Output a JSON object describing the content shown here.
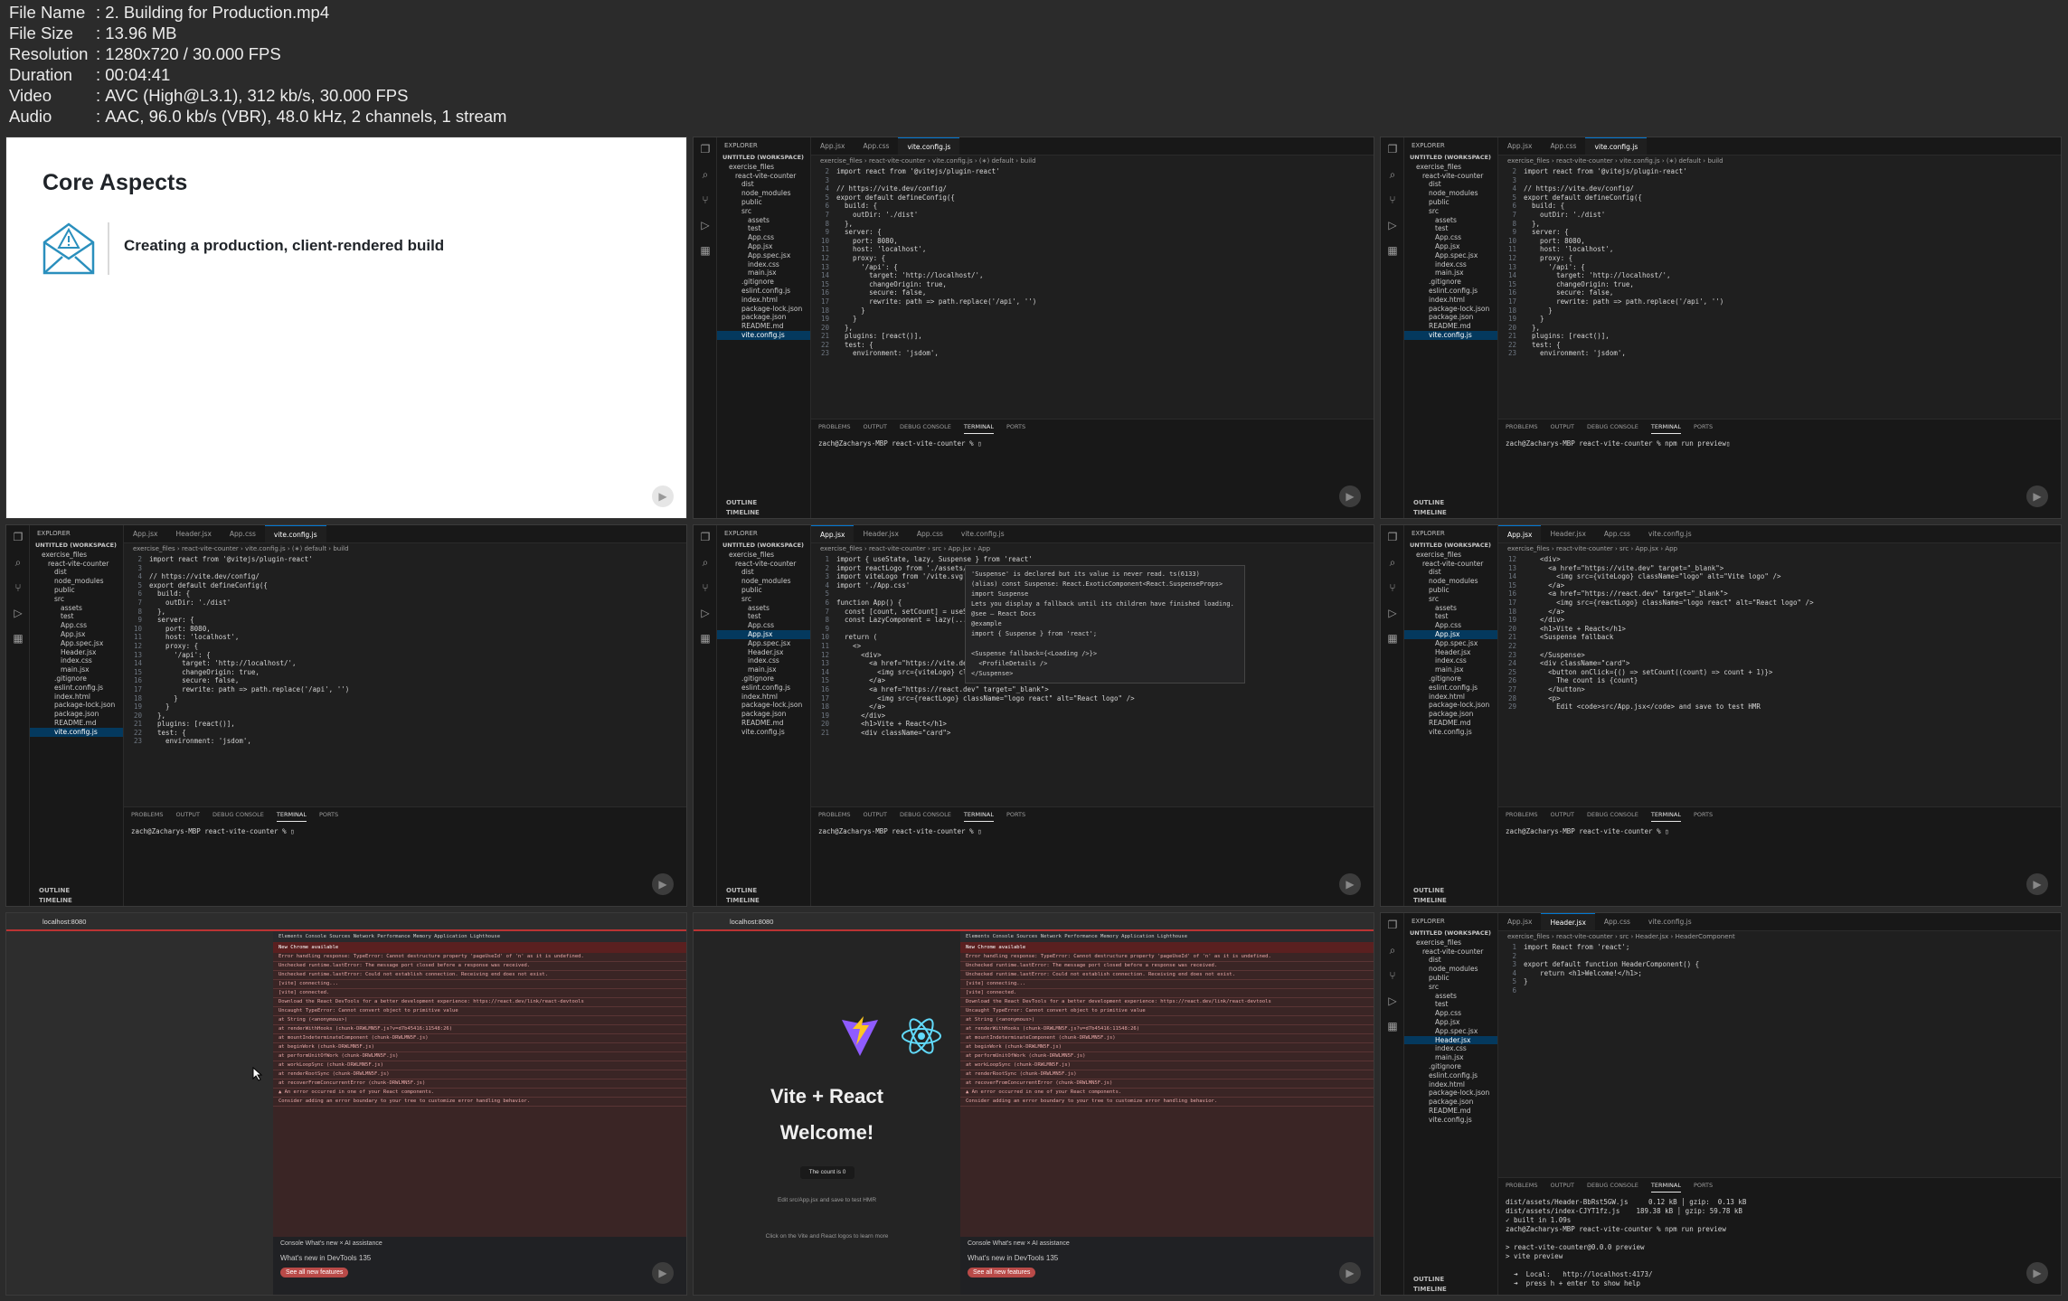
{
  "meta": [
    {
      "key": "File Name",
      "value": "2. Building for Production.mp4"
    },
    {
      "key": "File Size",
      "value": "13.96 MB"
    },
    {
      "key": "Resolution",
      "value": "1280x720 / 30.000 FPS"
    },
    {
      "key": "Duration",
      "value": "00:04:41"
    },
    {
      "key": "Video",
      "value": "AVC (High@L3.1), 312 kb/s, 30.000 FPS"
    },
    {
      "key": "Audio",
      "value": "AAC, 96.0 kb/s (VBR), 48.0 kHz, 2 channels, 1 stream"
    }
  ],
  "slide": {
    "title": "Core Aspects",
    "item": "Creating a production, client-rendered build"
  },
  "vscode": {
    "explorer": "EXPLORER",
    "workspace": "UNTITLED (WORKSPACE)",
    "outline": "OUTLINE",
    "timeline": "TIMELINE",
    "panel_tabs": [
      "PROBLEMS",
      "OUTPUT",
      "DEBUG CONSOLE",
      "TERMINAL",
      "PORTS"
    ],
    "prompt": "zach@Zacharys-MBP react-vite-counter % ",
    "tree_a": [
      "exercise_files",
      "react-vite-counter",
      "dist",
      "node_modules",
      "public",
      "src",
      "assets",
      "test",
      "App.css",
      "App.jsx",
      "App.spec.jsx",
      "index.css",
      "main.jsx",
      ".gitignore",
      "eslint.config.js",
      "index.html",
      "package-lock.json",
      "package.json",
      "README.md",
      "vite.config.js"
    ],
    "tree_b": [
      "exercise_files",
      "react-vite-counter",
      "dist",
      "node_modules",
      "public",
      "src",
      "assets",
      "test",
      "App.css",
      "App.jsx",
      "App.spec.jsx",
      "Header.jsx",
      "index.css",
      "main.jsx",
      ".gitignore",
      "eslint.config.js",
      "index.html",
      "package-lock.json",
      "package.json",
      "README.md",
      "vite.config.js"
    ],
    "tabs_a": [
      "App.jsx",
      "App.css",
      "vite.config.js"
    ],
    "tabs_b": [
      "App.jsx",
      "Header.jsx",
      "App.css",
      "vite.config.js"
    ],
    "crumb_vite": "exercise_files › react-vite-counter › vite.config.js › (∗) default › build",
    "crumb_app": "exercise_files › react-vite-counter › src › App.jsx › App",
    "crumb_header": "exercise_files › react-vite-counter › src › Header.jsx › HeaderComponent",
    "vite_code": [
      {
        "n": "2",
        "t": "import react from '@vitejs/plugin-react'"
      },
      {
        "n": "3",
        "t": ""
      },
      {
        "n": "4",
        "t": "// https://vite.dev/config/"
      },
      {
        "n": "5",
        "t": "export default defineConfig({"
      },
      {
        "n": "6",
        "t": "  build: {"
      },
      {
        "n": "7",
        "t": "    outDir: './dist'"
      },
      {
        "n": "8",
        "t": "  },"
      },
      {
        "n": "9",
        "t": "  server: {"
      },
      {
        "n": "10",
        "t": "    port: 8080,"
      },
      {
        "n": "11",
        "t": "    host: 'localhost',"
      },
      {
        "n": "12",
        "t": "    proxy: {"
      },
      {
        "n": "13",
        "t": "      '/api': {"
      },
      {
        "n": "14",
        "t": "        target: 'http://localhost/',"
      },
      {
        "n": "15",
        "t": "        changeOrigin: true,"
      },
      {
        "n": "16",
        "t": "        secure: false,"
      },
      {
        "n": "17",
        "t": "        rewrite: path => path.replace('/api', '')"
      },
      {
        "n": "18",
        "t": "      }"
      },
      {
        "n": "19",
        "t": "    }"
      },
      {
        "n": "20",
        "t": "  },"
      },
      {
        "n": "21",
        "t": "  plugins: [react()],"
      },
      {
        "n": "22",
        "t": "  test: {"
      },
      {
        "n": "23",
        "t": "    environment: 'jsdom',"
      }
    ],
    "app_code": [
      {
        "n": "1",
        "t": "import { useState, lazy, Suspense } from 'react'"
      },
      {
        "n": "2",
        "t": "import reactLogo from './assets/react.svg'"
      },
      {
        "n": "3",
        "t": "import viteLogo from '/vite.svg'"
      },
      {
        "n": "4",
        "t": "import './App.css'"
      },
      {
        "n": "5",
        "t": ""
      },
      {
        "n": "6",
        "t": "function App() {"
      },
      {
        "n": "7",
        "t": "  const [count, setCount] = useState(0)"
      },
      {
        "n": "8",
        "t": "  const LazyComponent = lazy(..."
      },
      {
        "n": "9",
        "t": ""
      },
      {
        "n": "10",
        "t": "  return ("
      },
      {
        "n": "11",
        "t": "    <>"
      },
      {
        "n": "12",
        "t": "      <div>"
      },
      {
        "n": "13",
        "t": "        <a href=\"https://vite.dev\" target=\"_blank\">"
      },
      {
        "n": "14",
        "t": "          <img src={viteLogo} className=\"logo\" alt=\"Vite logo\" />"
      },
      {
        "n": "15",
        "t": "        </a>"
      },
      {
        "n": "16",
        "t": "        <a href=\"https://react.dev\" target=\"_blank\">"
      },
      {
        "n": "17",
        "t": "          <img src={reactLogo} className=\"logo react\" alt=\"React logo\" />"
      },
      {
        "n": "18",
        "t": "        </a>"
      },
      {
        "n": "19",
        "t": "      </div>"
      },
      {
        "n": "20",
        "t": "      <h1>Vite + React</h1>"
      },
      {
        "n": "21",
        "t": "      <div className=\"card\">"
      }
    ],
    "hover": "'Suspense' is declared but its value is never read. ts(6133)\n(alias) const Suspense: React.ExoticComponent<React.SuspenseProps>\nimport Suspense\nLets you display a fallback until its children have finished loading.\n@see — React Docs\n@example\nimport { Suspense } from 'react';\n\n<Suspense fallback={<Loading />}>\n  <ProfileDetails />\n</Suspense>",
    "app_code2": [
      {
        "n": "12",
        "t": "    <div>"
      },
      {
        "n": "13",
        "t": "      <a href=\"https://vite.dev\" target=\"_blank\">"
      },
      {
        "n": "14",
        "t": "        <img src={viteLogo} className=\"logo\" alt=\"Vite logo\" />"
      },
      {
        "n": "15",
        "t": "      </a>"
      },
      {
        "n": "16",
        "t": "      <a href=\"https://react.dev\" target=\"_blank\">"
      },
      {
        "n": "17",
        "t": "        <img src={reactLogo} className=\"logo react\" alt=\"React logo\" />"
      },
      {
        "n": "18",
        "t": "      </a>"
      },
      {
        "n": "19",
        "t": "    </div>"
      },
      {
        "n": "20",
        "t": "    <h1>Vite + React</h1>"
      },
      {
        "n": "21",
        "t": "    <Suspense fallback"
      },
      {
        "n": "22",
        "t": ""
      },
      {
        "n": "23",
        "t": "    </Suspense>"
      },
      {
        "n": "24",
        "t": "    <div className=\"card\">"
      },
      {
        "n": "25",
        "t": "      <button onClick={() => setCount((count) => count + 1)}>"
      },
      {
        "n": "26",
        "t": "        The count is {count}"
      },
      {
        "n": "27",
        "t": "      </button>"
      },
      {
        "n": "28",
        "t": "      <p>"
      },
      {
        "n": "29",
        "t": "        Edit <code>src/App.jsx</code> and save to test HMR"
      }
    ],
    "header_code": [
      {
        "n": "1",
        "t": "import React from 'react';"
      },
      {
        "n": "2",
        "t": ""
      },
      {
        "n": "3",
        "t": "export default function HeaderComponent() {"
      },
      {
        "n": "4",
        "t": "    return <h1>Welcome!</h1>;"
      },
      {
        "n": "5",
        "t": "}"
      },
      {
        "n": "6",
        "t": ""
      }
    ],
    "cmd_preview": "npm run preview",
    "build_out": "dist/assets/Header-BbRst5GW.js     0.12 kB │ gzip:  0.13 kB\ndist/assets/index-CJYT1fz.js    189.38 kB │ gzip: 59.78 kB\n✓ built in 1.09s\nzach@Zacharys-MBP react-vite-counter % npm run preview\n\n> react-vite-counter@0.0.0 preview\n> vite preview\n\n  ➜  Local:   http://localhost:4173/\n  ➜  press h + enter to show help"
  },
  "browser": {
    "url": "localhost:8080",
    "new_chrome": "New Chrome available",
    "devtools_tabs": "Elements  Console  Sources  Network  Performance  Memory  Application  Lighthouse",
    "errors": [
      "Error handling response: TypeError: Cannot destructure property 'pageUseId' of 'n' as it is undefined.",
      "Unchecked runtime.lastError: The message port closed before a response was received.",
      "Unchecked runtime.lastError: Could not establish connection. Receiving end does not exist.",
      "[vite] connecting...",
      "[vite] connected.",
      "Download the React DevTools for a better development experience: https://react.dev/link/react-devtools",
      "Uncaught TypeError: Cannot convert object to primitive value",
      "  at String (<anonymous>)",
      "  at renderWithHooks (chunk-DRWLMN5F.js?v=d7b45416:11548:26)",
      "  at mountIndeterminateComponent (chunk-DRWLMN5F.js)",
      "  at beginWork (chunk-DRWLMN5F.js)",
      "  at performUnitOfWork (chunk-DRWLMN5F.js)",
      "  at workLoopSync (chunk-DRWLMN5F.js)",
      "  at renderRootSync (chunk-DRWLMN5F.js)",
      "  at recoverFromConcurrentError (chunk-DRWLMN5F.js)",
      "▲ An error occurred in one of your React components.",
      "Consider adding an error boundary to your tree to customize error handling behavior."
    ],
    "drawer_tabs": "Console   What's new ×   AI assistance",
    "whats_new": "What's new in DevTools 135",
    "see_all": "See all new features",
    "vite_title": "Vite + React",
    "welcome": "Welcome!",
    "count": "The count is 0",
    "edit": "Edit src/App.jsx and save to test HMR",
    "learn": "Click on the Vite and React logos to learn more"
  }
}
